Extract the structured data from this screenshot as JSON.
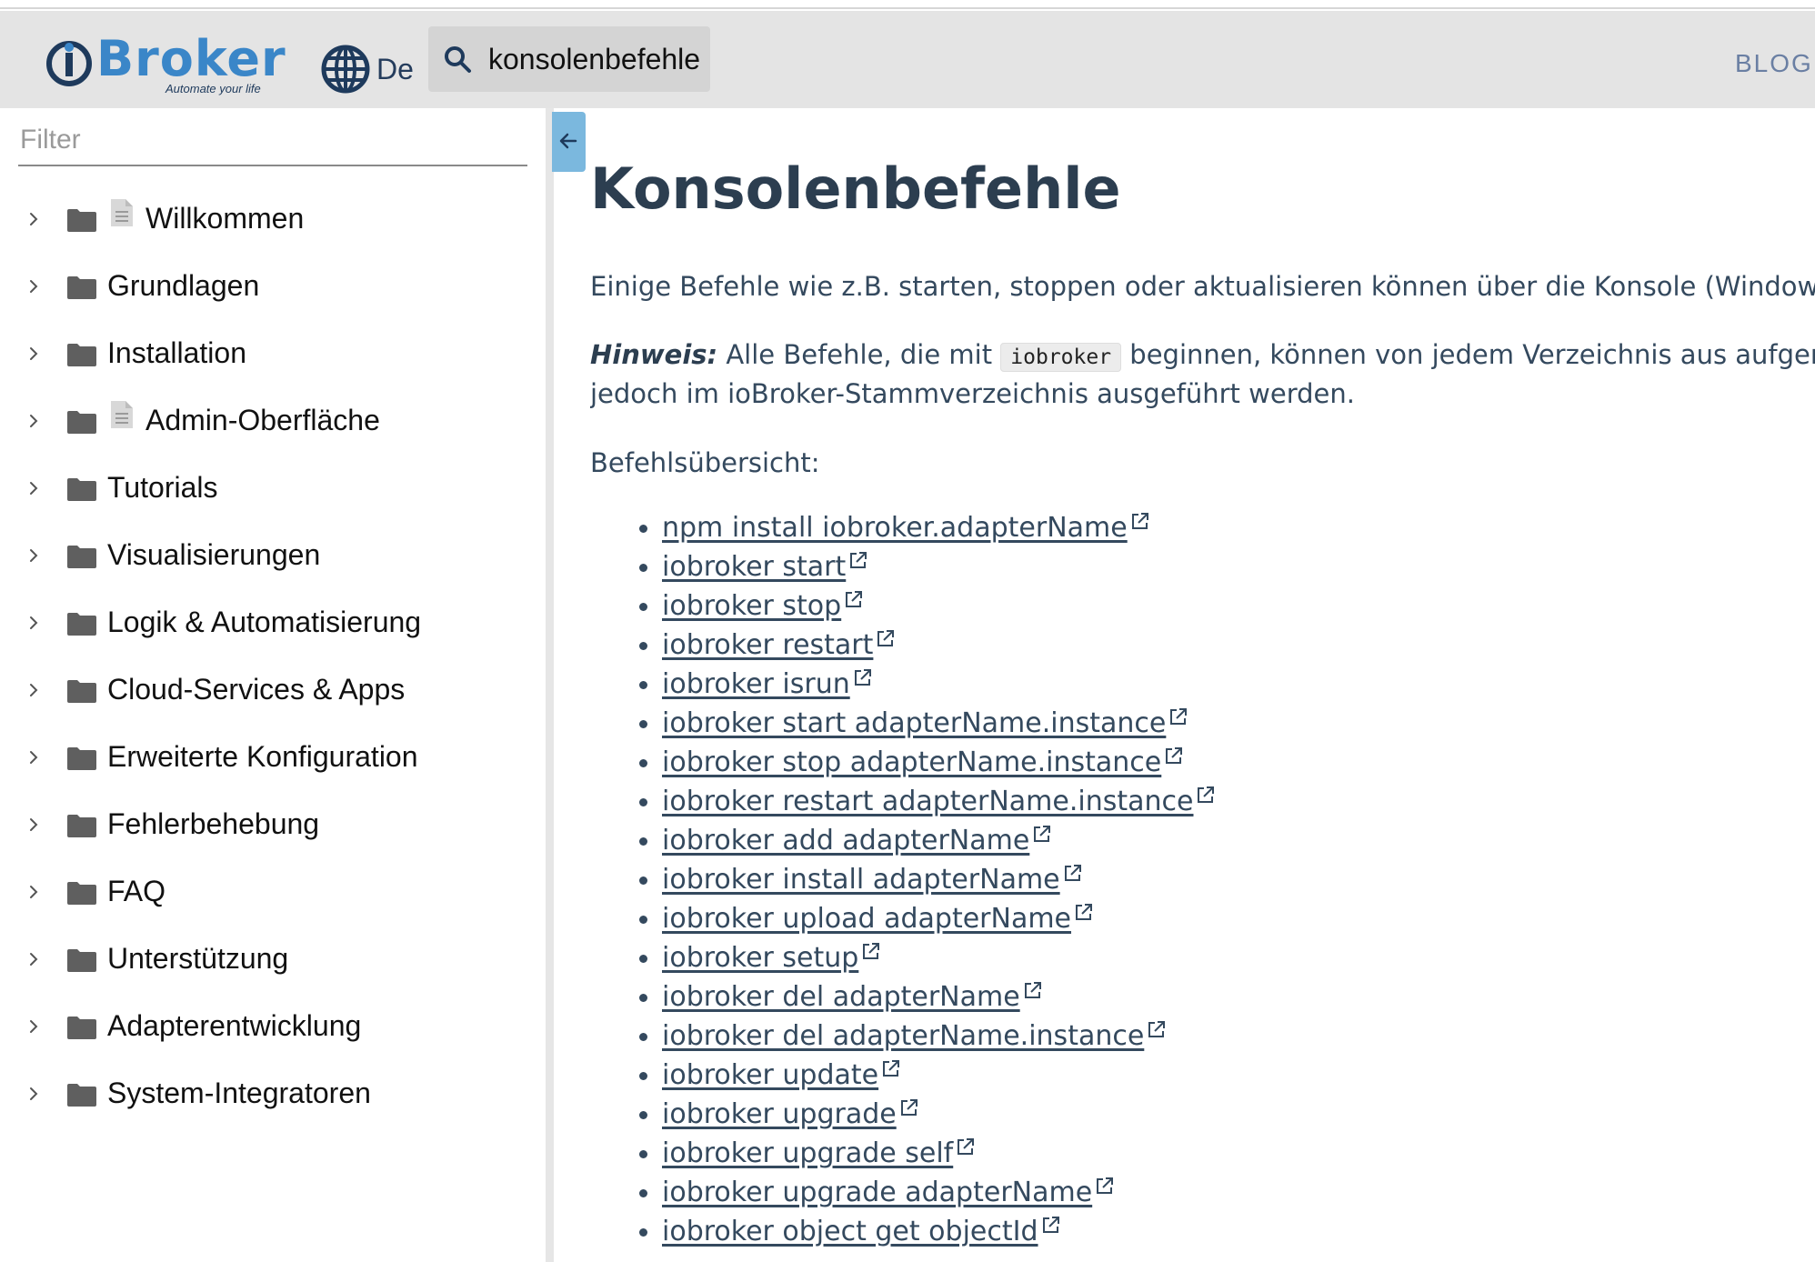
{
  "header": {
    "logo_text": "Broker",
    "logo_tagline": "Automate your life",
    "language": "De",
    "search_value": "konsolenbefehle",
    "blog_label": "BLOG"
  },
  "sidebar": {
    "filter_placeholder": "Filter",
    "items": [
      {
        "label": "Willkommen",
        "has_doc_icon": true
      },
      {
        "label": "Grundlagen",
        "has_doc_icon": false
      },
      {
        "label": "Installation",
        "has_doc_icon": false
      },
      {
        "label": "Admin-Oberfläche",
        "has_doc_icon": true
      },
      {
        "label": "Tutorials",
        "has_doc_icon": false
      },
      {
        "label": "Visualisierungen",
        "has_doc_icon": false
      },
      {
        "label": "Logik & Automatisierung",
        "has_doc_icon": false
      },
      {
        "label": "Cloud-Services & Apps",
        "has_doc_icon": false
      },
      {
        "label": "Erweiterte Konfiguration",
        "has_doc_icon": false
      },
      {
        "label": "Fehlerbehebung",
        "has_doc_icon": false
      },
      {
        "label": "FAQ",
        "has_doc_icon": false
      },
      {
        "label": "Unterstützung",
        "has_doc_icon": false
      },
      {
        "label": "Adapterentwicklung",
        "has_doc_icon": false
      },
      {
        "label": "System-Integratoren",
        "has_doc_icon": false
      }
    ]
  },
  "content": {
    "title": "Konsolenbefehle",
    "intro": "Einige Befehle wie z.B. starten, stoppen oder aktualisieren können über die Konsole (Windows bzw",
    "hint_label": "Hinweis:",
    "hint_before_code": " Alle Befehle, die mit ",
    "hint_code": "iobroker",
    "hint_after_code": " beginnen, können von jedem Verzeichnis aus aufgerufen",
    "hint_line2": "jedoch im ioBroker-Stammverzeichnis ausgeführt werden.",
    "overview_label": "Befehlsübersicht:",
    "commands": [
      "npm install iobroker.adapterName",
      "iobroker start",
      "iobroker stop",
      "iobroker restart",
      "iobroker isrun",
      "iobroker start adapterName.instance",
      "iobroker stop adapterName.instance",
      "iobroker restart adapterName.instance",
      "iobroker add adapterName",
      "iobroker install adapterName",
      "iobroker upload adapterName",
      "iobroker setup",
      "iobroker del adapterName",
      "iobroker del adapterName.instance",
      "iobroker update",
      "iobroker upgrade",
      "iobroker upgrade self",
      "iobroker upgrade adapterName",
      "iobroker object get objectId"
    ]
  },
  "colors": {
    "header_bg": "#e4e4e4",
    "logo_blue": "#3a86c8",
    "text_dark": "#34495e",
    "collapse_button": "#7bb8de"
  }
}
